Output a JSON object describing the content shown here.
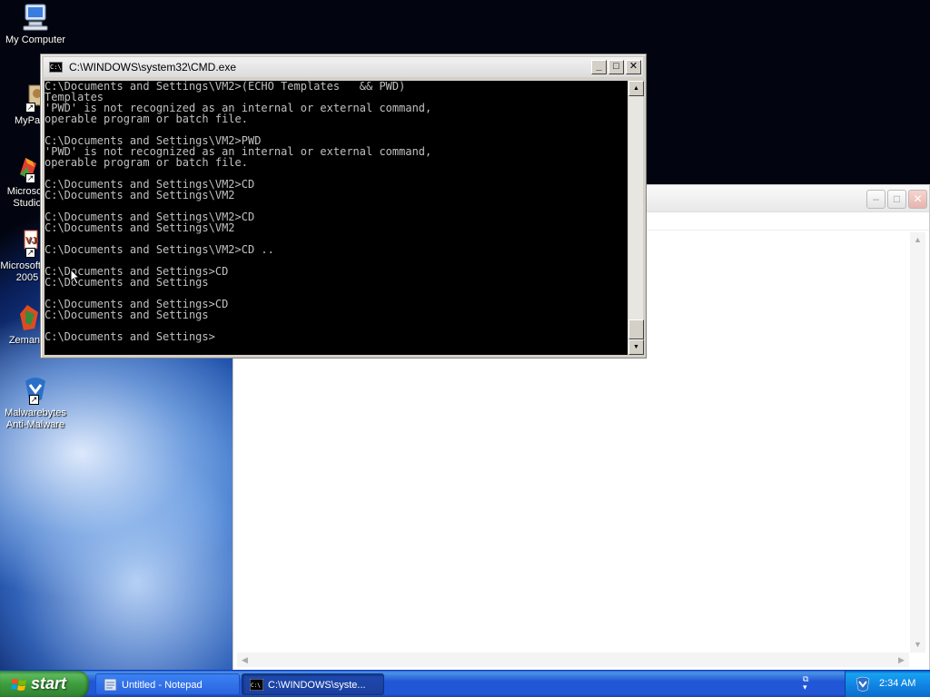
{
  "desktop": {
    "icons": [
      {
        "label": "My Computer"
      },
      {
        "label": "MyPa"
      },
      {
        "label": "Microsoft Studio"
      },
      {
        "label": "Microsoft J# 2005"
      },
      {
        "label": "Zemana"
      },
      {
        "label": "Malwarebytes Anti-Malware"
      }
    ]
  },
  "cmd_window": {
    "title": "C:\\WINDOWS\\system32\\CMD.exe",
    "minimize": "_",
    "maximize": "□",
    "close": "✕",
    "icon_text": "C:\\",
    "lines": [
      "C:\\Documents and Settings\\VM2>(ECHO Templates   && PWD)",
      "Templates",
      "'PWD' is not recognized as an internal or external command,",
      "operable program or batch file.",
      "",
      "C:\\Documents and Settings\\VM2>PWD",
      "'PWD' is not recognized as an internal or external command,",
      "operable program or batch file.",
      "",
      "C:\\Documents and Settings\\VM2>CD",
      "C:\\Documents and Settings\\VM2",
      "",
      "C:\\Documents and Settings\\VM2>CD",
      "C:\\Documents and Settings\\VM2",
      "",
      "C:\\Documents and Settings\\VM2>CD ..",
      "",
      "C:\\Documents and Settings>CD",
      "C:\\Documents and Settings",
      "",
      "C:\\Documents and Settings>CD",
      "C:\\Documents and Settings",
      "",
      "C:\\Documents and Settings>"
    ]
  },
  "notepad_window": {
    "minimize": "–",
    "maximize": "□",
    "close": "✕"
  },
  "taskbar": {
    "start_label": "start",
    "tasks": [
      {
        "label": "Untitled - Notepad"
      },
      {
        "label": "C:\\WINDOWS\\syste..."
      }
    ],
    "clock": "2:34 AM"
  }
}
